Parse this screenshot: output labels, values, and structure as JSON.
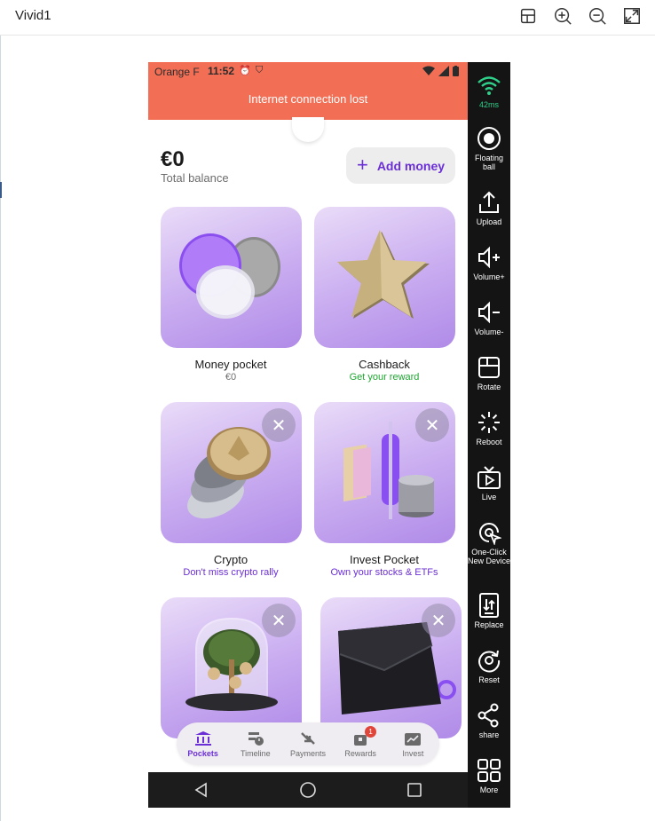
{
  "window": {
    "title": "Vivid1"
  },
  "titlebar_icons": [
    "rotate-icon",
    "zoom-in-icon",
    "zoom-out-icon",
    "fullscreen-icon"
  ],
  "status_bar": {
    "carrier": "Orange F",
    "time": "11:52"
  },
  "banner": {
    "text": "Internet connection lost"
  },
  "balance": {
    "amount": "€0",
    "label": "Total balance"
  },
  "add_money": {
    "label": "Add money"
  },
  "cards": [
    {
      "title": "Money pocket",
      "subtitle": "€0",
      "subtitle_color": "#6d6d6d"
    },
    {
      "title": "Cashback",
      "subtitle": "Get your reward",
      "subtitle_color": "#1fa531"
    },
    {
      "title": "Crypto",
      "subtitle": "Don't miss crypto rally",
      "subtitle_color": "#6b2fd6"
    },
    {
      "title": "Invest Pocket",
      "subtitle": "Own your stocks & ETFs",
      "subtitle_color": "#6b2fd6"
    }
  ],
  "bottom_nav": {
    "items": [
      {
        "label": "Pockets",
        "icon": "bank-icon",
        "active": true
      },
      {
        "label": "Timeline",
        "icon": "timeline-icon"
      },
      {
        "label": "Payments",
        "icon": "payments-icon"
      },
      {
        "label": "Rewards",
        "icon": "rewards-icon",
        "badge": "1"
      },
      {
        "label": "Invest",
        "icon": "invest-icon"
      }
    ]
  },
  "sidebar": {
    "latency": "42ms",
    "items": [
      {
        "label": "Floating ball",
        "icon": "floating-ball-icon"
      },
      {
        "label": "Upload",
        "icon": "upload-icon"
      },
      {
        "label": "Volume+",
        "icon": "volume-up-icon"
      },
      {
        "label": "Volume-",
        "icon": "volume-down-icon"
      },
      {
        "label": "Rotate",
        "icon": "rotate-icon"
      },
      {
        "label": "Reboot",
        "icon": "reboot-icon"
      },
      {
        "label": "Live",
        "icon": "live-icon"
      },
      {
        "label": "One-Click New Device",
        "icon": "new-device-icon"
      },
      {
        "label": "Replace",
        "icon": "replace-icon"
      },
      {
        "label": "Reset",
        "icon": "reset-icon"
      },
      {
        "label": "share",
        "icon": "share-icon"
      },
      {
        "label": "More",
        "icon": "more-icon"
      }
    ]
  },
  "colors": {
    "accent": "#6b2fd6",
    "banner": "#f26f56",
    "success": "#1fa531"
  }
}
